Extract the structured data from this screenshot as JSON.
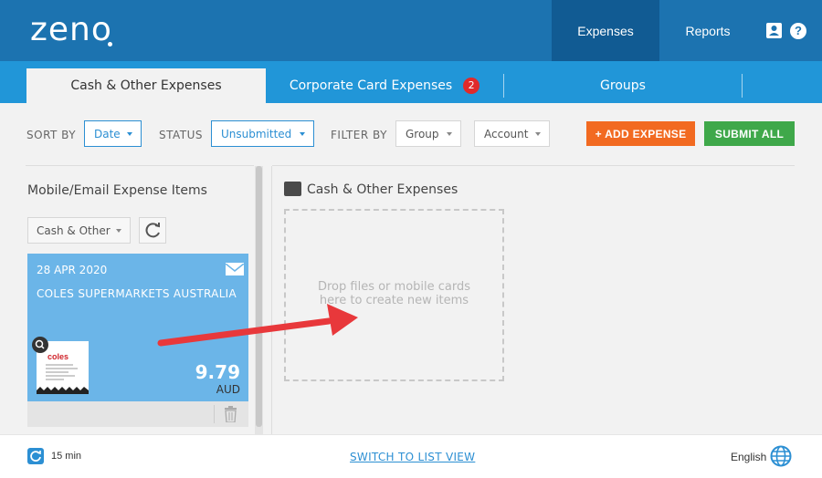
{
  "header": {
    "logo": "zeno",
    "nav": {
      "expenses": "Expenses",
      "reports": "Reports"
    },
    "icons": [
      "user-icon",
      "help-icon"
    ],
    "help_glyph": "?"
  },
  "tabs": {
    "cash": "Cash & Other Expenses",
    "corporate": "Corporate Card Expenses",
    "corporate_badge": "2",
    "groups": "Groups"
  },
  "filters": {
    "sort_label": "SORT BY",
    "sort_value": "Date",
    "status_label": "STATUS",
    "status_value": "Unsubmitted",
    "filter_label": "FILTER BY",
    "group_value": "Group",
    "account_value": "Account",
    "add_expense": "+ ADD EXPENSE",
    "submit_all": "SUBMIT ALL"
  },
  "left_panel": {
    "title": "Mobile/Email Expense Items",
    "type_select": "Cash & Other",
    "card": {
      "date": "28 APR 2020",
      "merchant": "COLES SUPERMARKETS AUSTRALIA",
      "receipt_logo": "coles",
      "amount": "9.79",
      "currency": "AUD"
    }
  },
  "dropzone": {
    "title": "Cash & Other Expenses",
    "line1": "Drop files or mobile cards",
    "line2": "here to create new items"
  },
  "footer": {
    "sync_interval": "15 min",
    "switch_view": "SWITCH TO LIST VIEW",
    "language": "English"
  },
  "colors": {
    "brand_dark": "#1c73b0",
    "tab_bar": "#2196d8",
    "orange": "#f26a21",
    "green": "#3fa84a",
    "card": "#6bb5e8",
    "arrow": "#e8383b"
  }
}
